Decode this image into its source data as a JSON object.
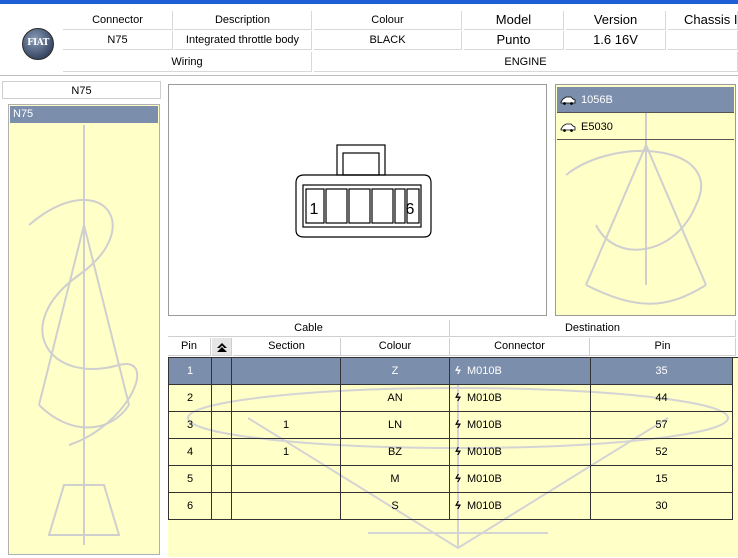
{
  "header": {
    "labels": {
      "connector": "Connector",
      "description": "Description",
      "colour": "Colour",
      "model": "Model",
      "version": "Version",
      "chassis": "Chassis I"
    },
    "values": {
      "connector": "N75",
      "description": "Integrated throttle body",
      "colour": "BLACK",
      "model": "Punto",
      "version": "1.6 16V",
      "chassis": ""
    },
    "wiring": "Wiring",
    "system": "ENGINE",
    "logo_text": "FIAT"
  },
  "left_panel": {
    "title": "N75",
    "items": [
      "N75"
    ]
  },
  "variants": {
    "items": [
      {
        "label": "1056B",
        "selected": true,
        "icon": "car-icon"
      },
      {
        "label": "E5030",
        "selected": false,
        "icon": "car-icon"
      }
    ]
  },
  "connector_diagram": {
    "pin_first": "1",
    "pin_last": "6"
  },
  "table": {
    "group_cable": "Cable",
    "group_destination": "Destination",
    "columns": {
      "pin": "Pin",
      "section": "Section",
      "colour": "Colour",
      "connector": "Connector",
      "dest_pin": "Pin"
    },
    "sort_icon": "sort-icon",
    "rows": [
      {
        "pin": "1",
        "section": "",
        "colour": "Z",
        "connector": "M010B",
        "dest_pin": "35"
      },
      {
        "pin": "2",
        "section": "",
        "colour": "AN",
        "connector": "M010B",
        "dest_pin": "44"
      },
      {
        "pin": "3",
        "section": "1",
        "colour": "LN",
        "connector": "M010B",
        "dest_pin": "57"
      },
      {
        "pin": "4",
        "section": "1",
        "colour": "BZ",
        "connector": "M010B",
        "dest_pin": "52"
      },
      {
        "pin": "5",
        "section": "",
        "colour": "M",
        "connector": "M010B",
        "dest_pin": "15"
      },
      {
        "pin": "6",
        "section": "",
        "colour": "S",
        "connector": "M010B",
        "dest_pin": "30"
      }
    ],
    "selected_row": 0
  },
  "colors": {
    "selected": "#7b8eac",
    "panel": "#ffffc8",
    "titlebar": "#1f5fd6"
  }
}
